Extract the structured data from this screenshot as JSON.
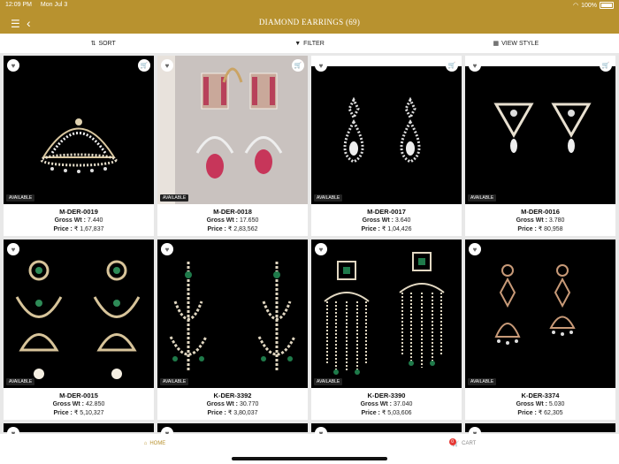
{
  "status": {
    "time": "12:09 PM",
    "date": "Mon Jul 3",
    "battery": "100%"
  },
  "header": {
    "title": "DIAMOND EARRINGS (69)"
  },
  "toolbar": {
    "sort": "SORT",
    "filter": "FILTER",
    "view": "VIEW STYLE"
  },
  "products": [
    {
      "code": "M-DER-0019",
      "gross_label": "Gross Wt :",
      "gross": "7.440",
      "price_label": "Price :",
      "price": "₹ 1,67,837",
      "availability": "AVAILABLE",
      "cart": true
    },
    {
      "code": "M-DER-0018",
      "gross_label": "Gross Wt :",
      "gross": "17.650",
      "price_label": "Price :",
      "price": "₹ 2,83,562",
      "availability": "AVAILABLE",
      "cart": true
    },
    {
      "code": "M-DER-0017",
      "gross_label": "Gross Wt :",
      "gross": "3.640",
      "price_label": "Price :",
      "price": "₹ 1,04,426",
      "availability": "AVAILABLE",
      "cart": true
    },
    {
      "code": "M-DER-0016",
      "gross_label": "Gross Wt :",
      "gross": "3.780",
      "price_label": "Price :",
      "price": "₹ 80,958",
      "availability": "AVAILABLE",
      "cart": true
    },
    {
      "code": "M-DER-0015",
      "gross_label": "Gross Wt :",
      "gross": "42.850",
      "price_label": "Price :",
      "price": "₹ 5,10,327",
      "availability": "AVAILABLE",
      "cart": false
    },
    {
      "code": "K-DER-3392",
      "gross_label": "Gross Wt :",
      "gross": "30.770",
      "price_label": "Price :",
      "price": "₹ 3,80,037",
      "availability": "AVAILABLE",
      "cart": false
    },
    {
      "code": "K-DER-3390",
      "gross_label": "Gross Wt :",
      "gross": "37.040",
      "price_label": "Price :",
      "price": "₹ 5,03,606",
      "availability": "AVAILABLE",
      "cart": false
    },
    {
      "code": "K-DER-3374",
      "gross_label": "Gross Wt :",
      "gross": "5.030",
      "price_label": "Price :",
      "price": "₹ 62,305",
      "availability": "AVAILABLE",
      "cart": false
    }
  ],
  "bottom_nav": {
    "home": "HOME",
    "cart": "CART",
    "cart_count": "0"
  },
  "colors": {
    "brand": "#b8922f",
    "badge": "#e53935"
  }
}
